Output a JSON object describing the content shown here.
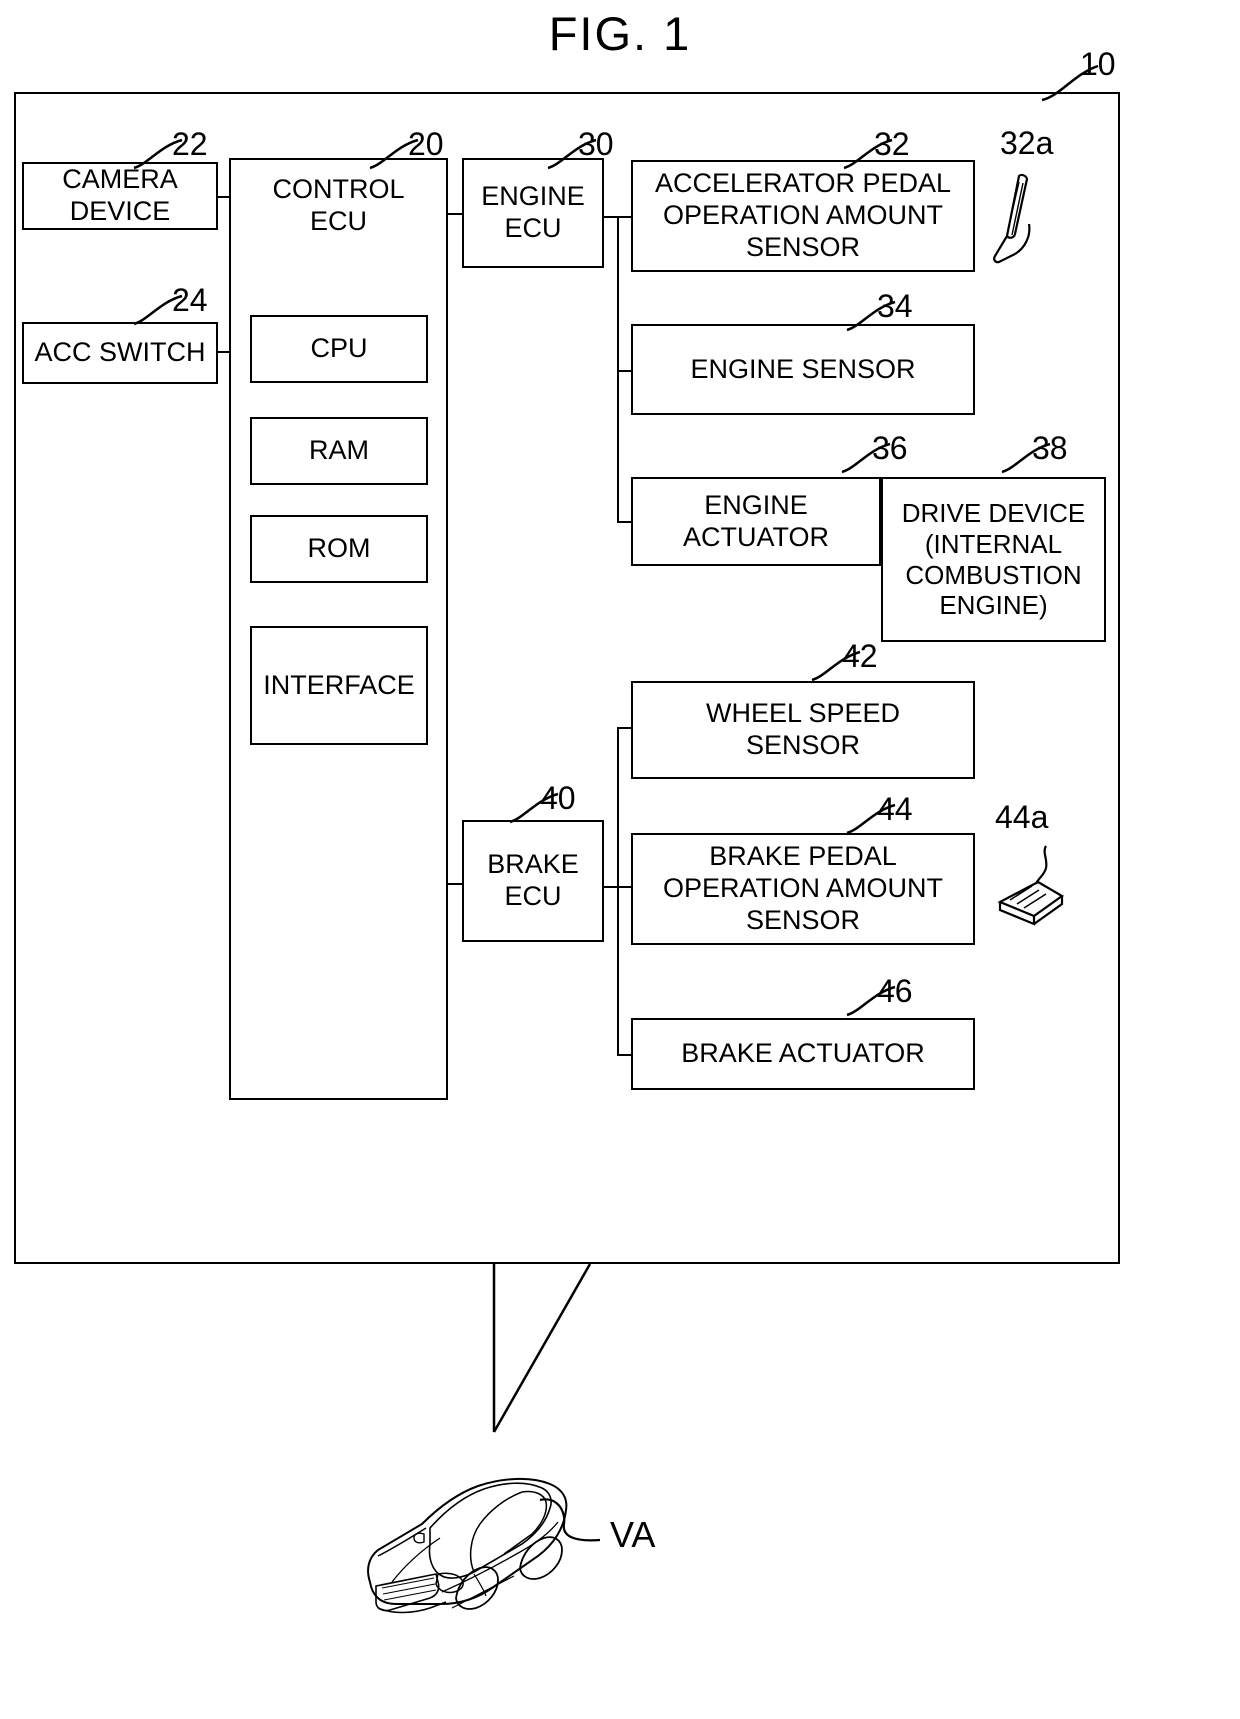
{
  "figure": {
    "title": "FIG. 1",
    "system_ref": "10",
    "vehicle_label": "VA"
  },
  "blocks": {
    "camera_device": {
      "label": "CAMERA\nDEVICE",
      "ref": "22"
    },
    "acc_switch": {
      "label": "ACC SWITCH",
      "ref": "24"
    },
    "control_ecu": {
      "label": "CONTROL\nECU",
      "ref": "20"
    },
    "cpu": {
      "label": "CPU"
    },
    "ram": {
      "label": "RAM"
    },
    "rom": {
      "label": "ROM"
    },
    "interface": {
      "label": "INTERFACE"
    },
    "engine_ecu": {
      "label": "ENGINE\nECU",
      "ref": "30"
    },
    "accel_pedal_sensor": {
      "label": "ACCELERATOR PEDAL\nOPERATION AMOUNT\nSENSOR",
      "ref": "32"
    },
    "accel_pedal_icon": {
      "ref": "32a",
      "icon": "accelerator-pedal-icon"
    },
    "engine_sensor": {
      "label": "ENGINE SENSOR",
      "ref": "34"
    },
    "engine_actuator": {
      "label": "ENGINE\nACTUATOR",
      "ref": "36"
    },
    "drive_device": {
      "label": "DRIVE DEVICE\n(INTERNAL\nCOMBUSTION\nENGINE)",
      "ref": "38"
    },
    "brake_ecu": {
      "label": "BRAKE\nECU",
      "ref": "40"
    },
    "wheel_speed_sensor": {
      "label": "WHEEL SPEED\nSENSOR",
      "ref": "42"
    },
    "brake_pedal_sensor": {
      "label": "BRAKE PEDAL\nOPERATION AMOUNT\nSENSOR",
      "ref": "44"
    },
    "brake_pedal_icon": {
      "ref": "44a",
      "icon": "brake-pedal-icon"
    },
    "brake_actuator": {
      "label": "BRAKE ACTUATOR",
      "ref": "46"
    }
  },
  "colors": {
    "ink": "#000000",
    "paper": "#ffffff"
  }
}
